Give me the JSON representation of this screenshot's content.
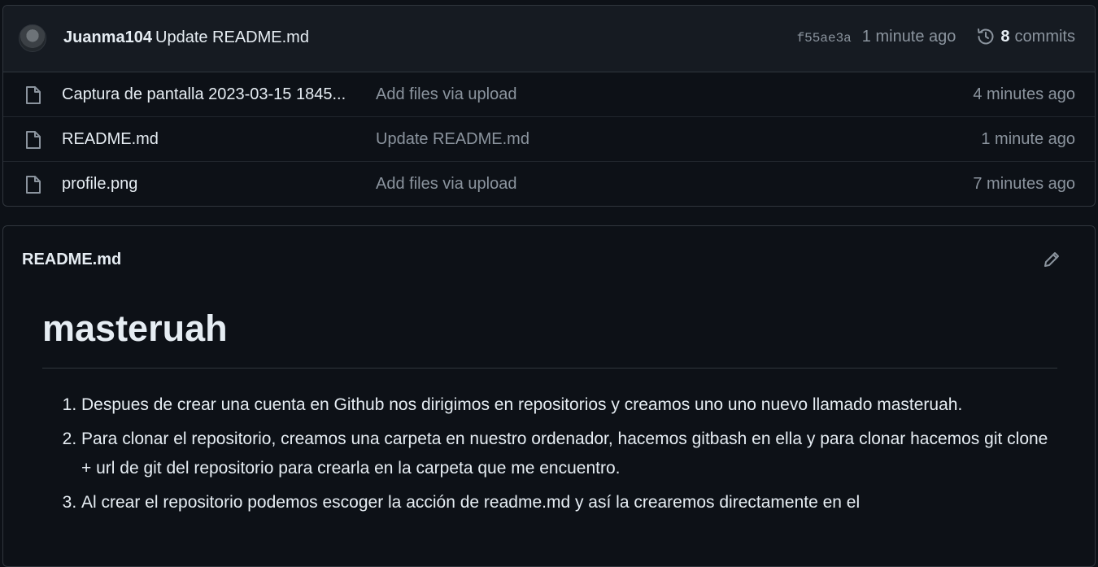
{
  "commit": {
    "author": "Juanma104",
    "message": "Update README.md",
    "sha": "f55ae3a",
    "time": "1 minute ago",
    "commits_count": "8",
    "commits_label": "commits"
  },
  "files": [
    {
      "name": "Captura de pantalla 2023-03-15 1845...",
      "commit_message": "Add files via upload",
      "age": "4 minutes ago",
      "icon": "file-icon"
    },
    {
      "name": "README.md",
      "commit_message": "Update README.md",
      "age": "1 minute ago",
      "icon": "file-icon"
    },
    {
      "name": "profile.png",
      "commit_message": "Add files via upload",
      "age": "7 minutes ago",
      "icon": "file-icon"
    }
  ],
  "readme": {
    "title": "README.md",
    "heading": "masteruah",
    "items": [
      "Despues de crear una cuenta en Github nos dirigimos en repositorios y creamos uno uno nuevo llamado masteruah.",
      "Para clonar el repositorio, creamos una carpeta en nuestro ordenador, hacemos gitbash en ella y para clonar hacemos git clone + url de git del repositorio para crearla en la carpeta que me encuentro.",
      "Al crear el repositorio podemos escoger la acción de readme.md y así la crearemos directamente en el"
    ]
  },
  "colors": {
    "background": "#0d1117",
    "header_bg": "#161b22",
    "border": "#30363d",
    "text": "#e6edf3",
    "muted": "#8b949e"
  },
  "icons": {
    "history": "history-icon",
    "file": "file-icon",
    "edit": "pencil-icon"
  }
}
